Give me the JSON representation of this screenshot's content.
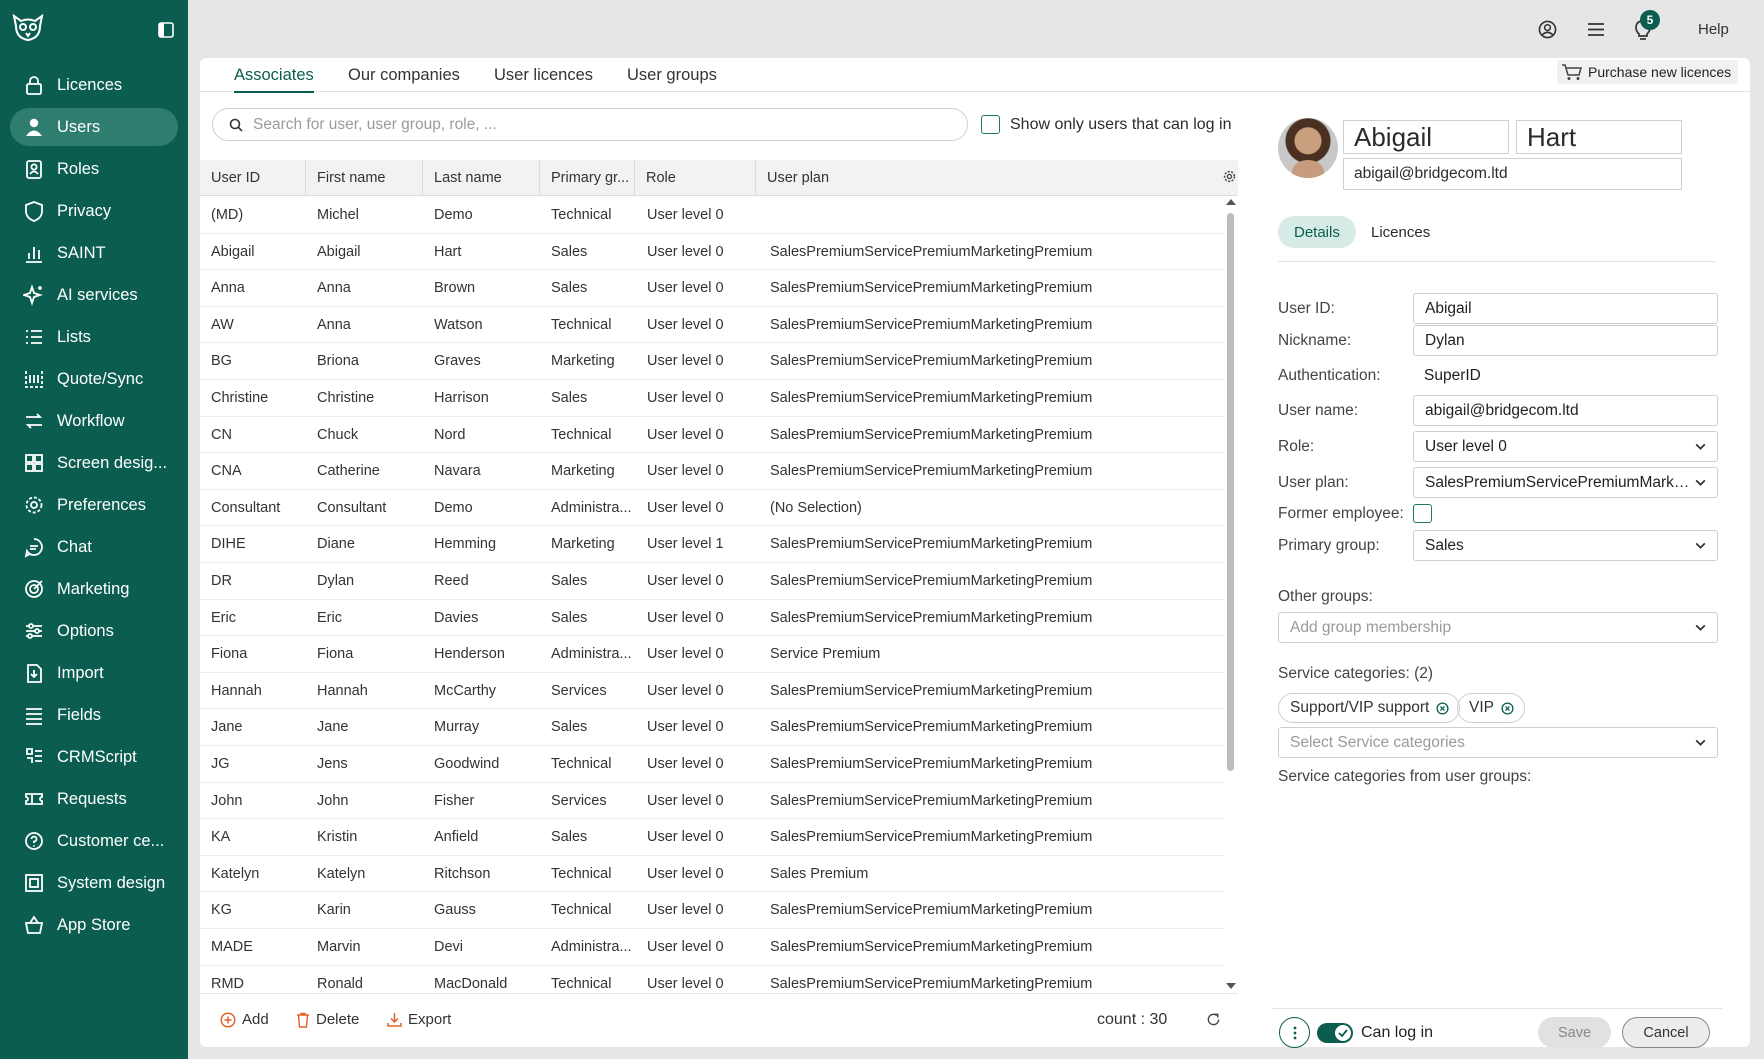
{
  "sidebar": {
    "items": [
      {
        "label": "Licences",
        "icon": "lock-icon"
      },
      {
        "label": "Users",
        "icon": "user-icon"
      },
      {
        "label": "Roles",
        "icon": "roles-icon"
      },
      {
        "label": "Privacy",
        "icon": "shield-icon"
      },
      {
        "label": "SAINT",
        "icon": "bar-chart-icon"
      },
      {
        "label": "AI services",
        "icon": "sparkle-icon"
      },
      {
        "label": "Lists",
        "icon": "list-icon"
      },
      {
        "label": "Quote/Sync",
        "icon": "sync-icon"
      },
      {
        "label": "Workflow",
        "icon": "workflow-icon"
      },
      {
        "label": "Screen desig...",
        "icon": "grid-icon"
      },
      {
        "label": "Preferences",
        "icon": "gear-icon"
      },
      {
        "label": "Chat",
        "icon": "chat-icon"
      },
      {
        "label": "Marketing",
        "icon": "target-icon"
      },
      {
        "label": "Options",
        "icon": "sliders-icon"
      },
      {
        "label": "Import",
        "icon": "import-icon"
      },
      {
        "label": "Fields",
        "icon": "fields-icon"
      },
      {
        "label": "CRMScript",
        "icon": "script-icon"
      },
      {
        "label": "Requests",
        "icon": "ticket-icon"
      },
      {
        "label": "Customer ce...",
        "icon": "help-circle-icon"
      },
      {
        "label": "System design",
        "icon": "system-design-icon"
      },
      {
        "label": "App Store",
        "icon": "basket-icon"
      }
    ],
    "active_index": 1
  },
  "topbar": {
    "notification_count": "5",
    "help_label": "Help"
  },
  "tabs": [
    {
      "label": "Associates"
    },
    {
      "label": "Our companies"
    },
    {
      "label": "User licences"
    },
    {
      "label": "User groups"
    }
  ],
  "purchase_label": "Purchase new licences",
  "search": {
    "placeholder": "Search for user, user group, role, ..."
  },
  "show_only_label": "Show only users that can log in",
  "table": {
    "columns": [
      "User ID",
      "First name",
      "Last name",
      "Primary gr...",
      "Role",
      "User plan"
    ],
    "rows": [
      [
        "(MD)",
        "Michel",
        "Demo",
        "Technical",
        "User level 0",
        ""
      ],
      [
        "Abigail",
        "Abigail",
        "Hart",
        "Sales",
        "User level 0",
        "SalesPremiumServicePremiumMarketingPremium"
      ],
      [
        "Anna",
        "Anna",
        "Brown",
        "Sales",
        "User level 0",
        "SalesPremiumServicePremiumMarketingPremium"
      ],
      [
        "AW",
        "Anna",
        "Watson",
        "Technical",
        "User level 0",
        "SalesPremiumServicePremiumMarketingPremium"
      ],
      [
        "BG",
        "Briona",
        "Graves",
        "Marketing",
        "User level 0",
        "SalesPremiumServicePremiumMarketingPremium"
      ],
      [
        "Christine",
        "Christine",
        "Harrison",
        "Sales",
        "User level 0",
        "SalesPremiumServicePremiumMarketingPremium"
      ],
      [
        "CN",
        "Chuck",
        "Nord",
        "Technical",
        "User level 0",
        "SalesPremiumServicePremiumMarketingPremium"
      ],
      [
        "CNA",
        "Catherine",
        "Navara",
        "Marketing",
        "User level 0",
        "SalesPremiumServicePremiumMarketingPremium"
      ],
      [
        "Consultant",
        "Consultant",
        "Demo",
        "Administra...",
        "User level 0",
        "(No Selection)"
      ],
      [
        "DIHE",
        "Diane",
        "Hemming",
        "Marketing",
        "User level 1",
        "SalesPremiumServicePremiumMarketingPremium"
      ],
      [
        "DR",
        "Dylan",
        "Reed",
        "Sales",
        "User level 0",
        "SalesPremiumServicePremiumMarketingPremium"
      ],
      [
        "Eric",
        "Eric",
        "Davies",
        "Sales",
        "User level 0",
        "SalesPremiumServicePremiumMarketingPremium"
      ],
      [
        "Fiona",
        "Fiona",
        "Henderson",
        "Administra...",
        "User level 0",
        "Service Premium"
      ],
      [
        "Hannah",
        "Hannah",
        "McCarthy",
        "Services",
        "User level 0",
        "SalesPremiumServicePremiumMarketingPremium"
      ],
      [
        "Jane",
        "Jane",
        "Murray",
        "Sales",
        "User level 0",
        "SalesPremiumServicePremiumMarketingPremium"
      ],
      [
        "JG",
        "Jens",
        "Goodwind",
        "Technical",
        "User level 0",
        "SalesPremiumServicePremiumMarketingPremium"
      ],
      [
        "John",
        "John",
        "Fisher",
        "Services",
        "User level 0",
        "SalesPremiumServicePremiumMarketingPremium"
      ],
      [
        "KA",
        "Kristin",
        "Anfield",
        "Sales",
        "User level 0",
        "SalesPremiumServicePremiumMarketingPremium"
      ],
      [
        "Katelyn",
        "Katelyn",
        "Ritchson",
        "Technical",
        "User level 0",
        "Sales Premium"
      ],
      [
        "KG",
        "Karin",
        "Gauss",
        "Technical",
        "User level 0",
        "SalesPremiumServicePremiumMarketingPremium"
      ],
      [
        "MADE",
        "Marvin",
        "Devi",
        "Administra...",
        "User level 0",
        "SalesPremiumServicePremiumMarketingPremium"
      ],
      [
        "RMD",
        "Ronald",
        "MacDonald",
        "Technical",
        "User level 0",
        "SalesPremiumServicePremiumMarketingPremium"
      ]
    ]
  },
  "footer": {
    "add_label": "Add",
    "delete_label": "Delete",
    "export_label": "Export",
    "count_text": "count : 30"
  },
  "detail": {
    "first_name": "Abigail",
    "last_name": "Hart",
    "email": "abigail@bridgecom.ltd",
    "tabs": [
      "Details",
      "Licences"
    ],
    "user_id_label": "User ID:",
    "user_id": "Abigail",
    "nickname_label": "Nickname:",
    "nickname": "Dylan",
    "auth_label": "Authentication:",
    "auth": "SuperID",
    "username_label": "User name:",
    "username": "abigail@bridgecom.ltd",
    "role_label": "Role:",
    "role": "User level 0",
    "user_plan_label": "User plan:",
    "user_plan": "SalesPremiumServicePremiumMarketingPremium",
    "former_label": "Former employee:",
    "primary_group_label": "Primary group:",
    "primary_group": "Sales",
    "other_groups_label": "Other groups:",
    "add_group_placeholder": "Add group membership",
    "service_categories_label": "Service categories: (2)",
    "service_chips": [
      "Support/VIP support",
      "VIP"
    ],
    "select_service_placeholder": "Select Service categories",
    "from_groups_label": "Service categories from user groups:",
    "can_login_label": "Can log in",
    "save_label": "Save",
    "cancel_label": "Cancel"
  },
  "colors": {
    "sidebar": "#0b5e4f",
    "accent": "#0b5e4f",
    "active_item": "#2f7d6e"
  }
}
